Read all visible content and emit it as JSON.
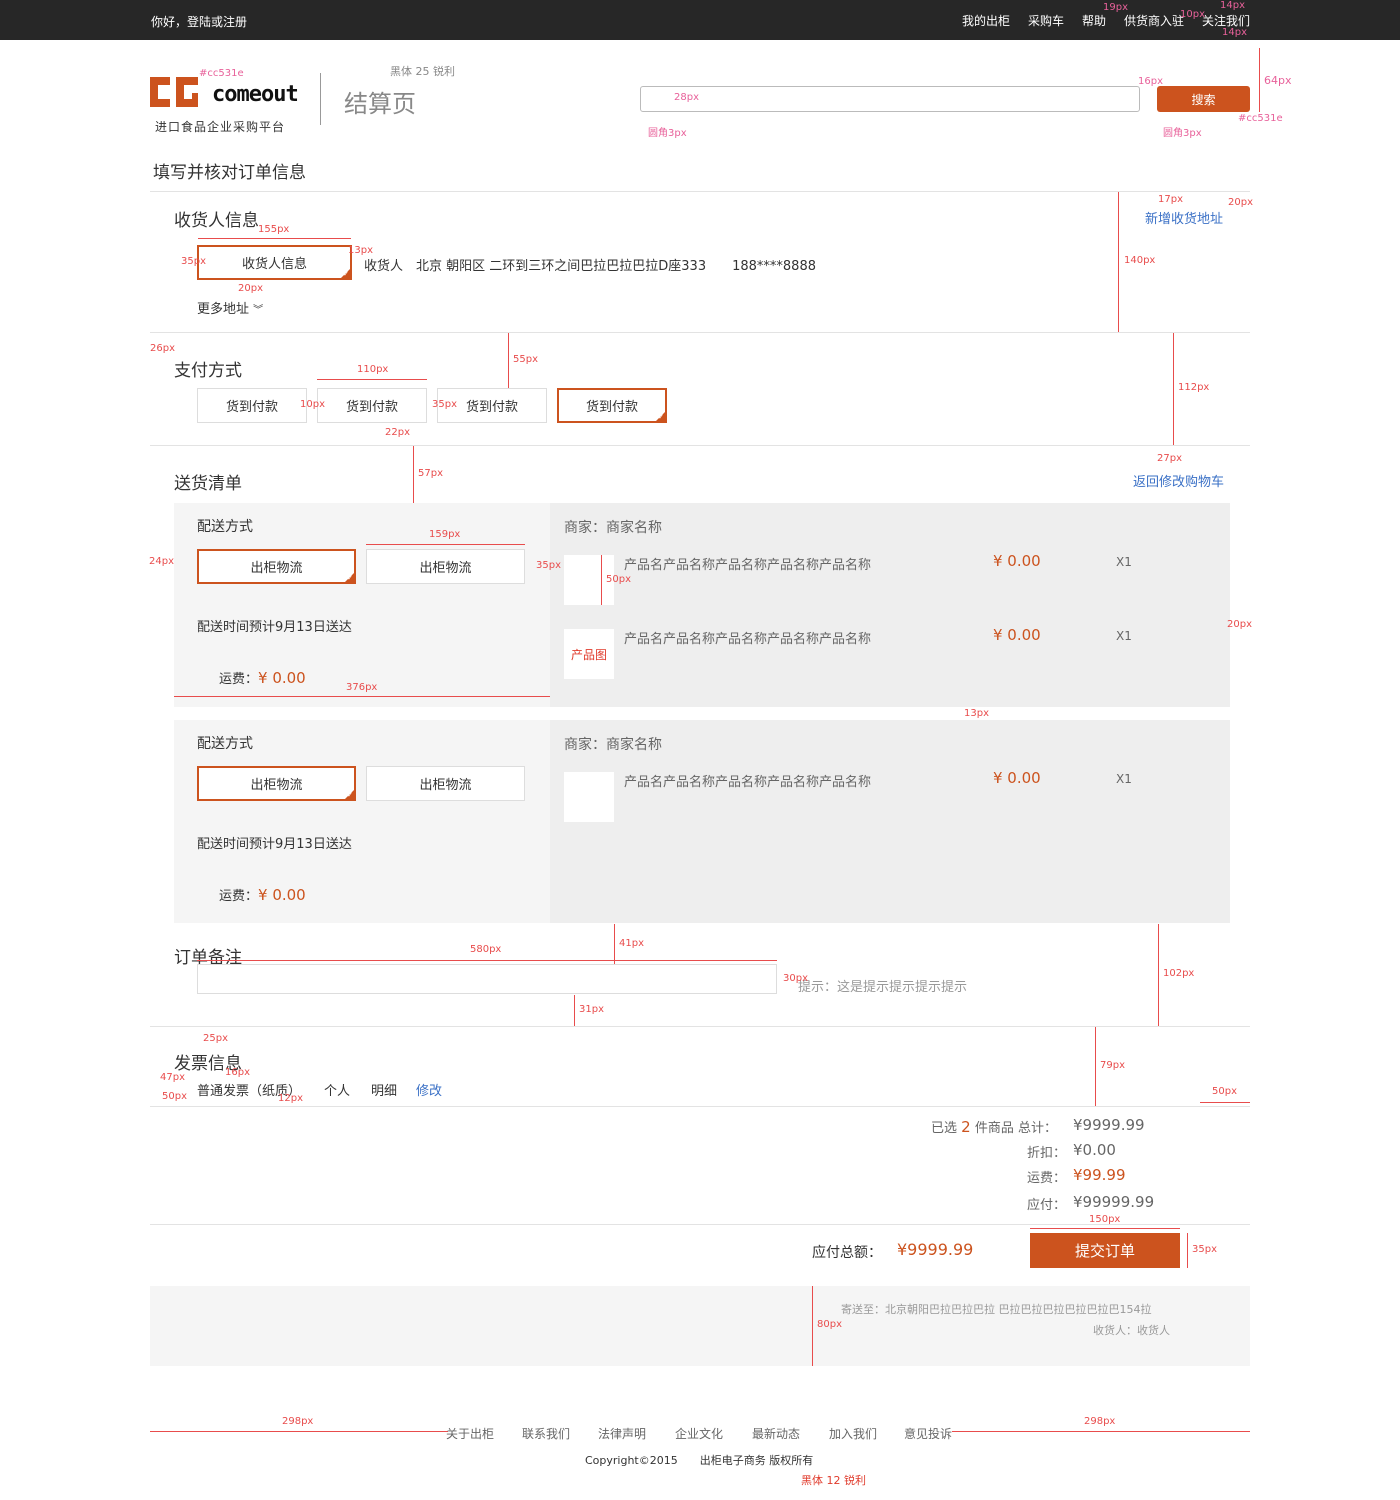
{
  "topbar": {
    "greeting": "你好，登陆或注册",
    "links": [
      "我的出柜",
      "采购车",
      "帮助",
      "供货商入驻",
      "关注我们"
    ]
  },
  "header": {
    "brand_text": "comeout",
    "slogan": "进口食品企业采购平台",
    "page_title": "结算页",
    "search_placeholder": "",
    "search_button": "搜索"
  },
  "main_title": "填写并核对订单信息",
  "receiver": {
    "title": "收货人信息",
    "add_link": "新增收货地址",
    "selected_label": "收货人信息",
    "address_line": "收货人　北京 朝阳区 二环到三环之间巴拉巴拉巴拉D座333　　188****8888",
    "more_address": "更多地址"
  },
  "payment": {
    "title": "支付方式",
    "options": [
      "货到付款",
      "货到付款",
      "货到付款",
      "货到付款"
    ]
  },
  "delivery": {
    "title": "送货清单",
    "back_link": "返回修改购物车",
    "groups": [
      {
        "method_title": "配送方式",
        "methods": [
          "出柜物流",
          "出柜物流"
        ],
        "eta": "配送时间预计9月13日送达",
        "fee_label": "运费：",
        "fee": "¥ 0.00",
        "merchant": "商家：商家名称",
        "items": [
          {
            "name": "产品名产品名称产品名称产品名称产品名称",
            "price": "¥ 0.00",
            "qty": "X1",
            "thumb": ""
          },
          {
            "name": "产品名产品名称产品名称产品名称产品名称",
            "price": "¥ 0.00",
            "qty": "X1",
            "thumb": "产品图"
          }
        ]
      },
      {
        "method_title": "配送方式",
        "methods": [
          "出柜物流",
          "出柜物流"
        ],
        "eta": "配送时间预计9月13日送达",
        "fee_label": "运费：",
        "fee": "¥ 0.00",
        "merchant": "商家：商家名称",
        "items": [
          {
            "name": "产品名产品名称产品名称产品名称产品名称",
            "price": "¥ 0.00",
            "qty": "X1",
            "thumb": ""
          }
        ]
      }
    ]
  },
  "remark": {
    "title": "订单备注",
    "hint": "提示：这是提示提示提示提示"
  },
  "invoice": {
    "title": "发票信息",
    "type": "普通发票（纸质）",
    "target": "个人",
    "content": "明细",
    "edit": "修改"
  },
  "summary": {
    "selected_prefix": "已选",
    "selected_count": "2",
    "selected_suffix": "件商品 总计：",
    "total": "¥9999.99",
    "discount_label": "折扣：",
    "discount": "¥0.00",
    "shipping_label": "运费：",
    "shipping": "¥99.99",
    "payable_label": "应付：",
    "payable": "¥99999.99",
    "grand_label": "应付总额：",
    "grand_total": "¥9999.99",
    "submit": "提交订单",
    "ship_to": "寄送至：北京朝阳巴拉巴拉巴拉 巴拉巴拉巴拉巴拉巴拉巴154拉",
    "consignee": "收货人：收货人"
  },
  "footer": {
    "links": [
      "关于出柜",
      "联系我们",
      "法律声明",
      "企业文化",
      "最新动态",
      "加入我们",
      "意见投诉"
    ],
    "copyright": "Copyright©2015　　出柜电子商务 版权所有"
  },
  "annotations": {
    "font_note_top": "黑体 25 锐利",
    "font_note_bottom": "黑体 12 锐利",
    "color_logo": "#cc531e",
    "color_button": "#cc531e",
    "r_search": "圆角3px",
    "r_button": "圆角3px",
    "dims": [
      "19px",
      "10px",
      "14px",
      "14px",
      "64px",
      "28px",
      "16px",
      "35px",
      "35px",
      "17px",
      "20px",
      "155px",
      "13px",
      "35px",
      "20px",
      "140px",
      "26px",
      "110px",
      "55px",
      "10px",
      "35px",
      "22px",
      "112px",
      "57px",
      "27px",
      "159px",
      "24px",
      "35px",
      "50px",
      "20px",
      "376px",
      "13px",
      "580px",
      "41px",
      "30px",
      "31px",
      "102px",
      "25px",
      "47px",
      "16px",
      "50px",
      "12px",
      "79px",
      "50px",
      "150px",
      "35px",
      "80px",
      "298px",
      "298px"
    ]
  },
  "colors": {
    "accent": "#cc531e",
    "link": "#3a70c6",
    "topbar": "#272727"
  }
}
